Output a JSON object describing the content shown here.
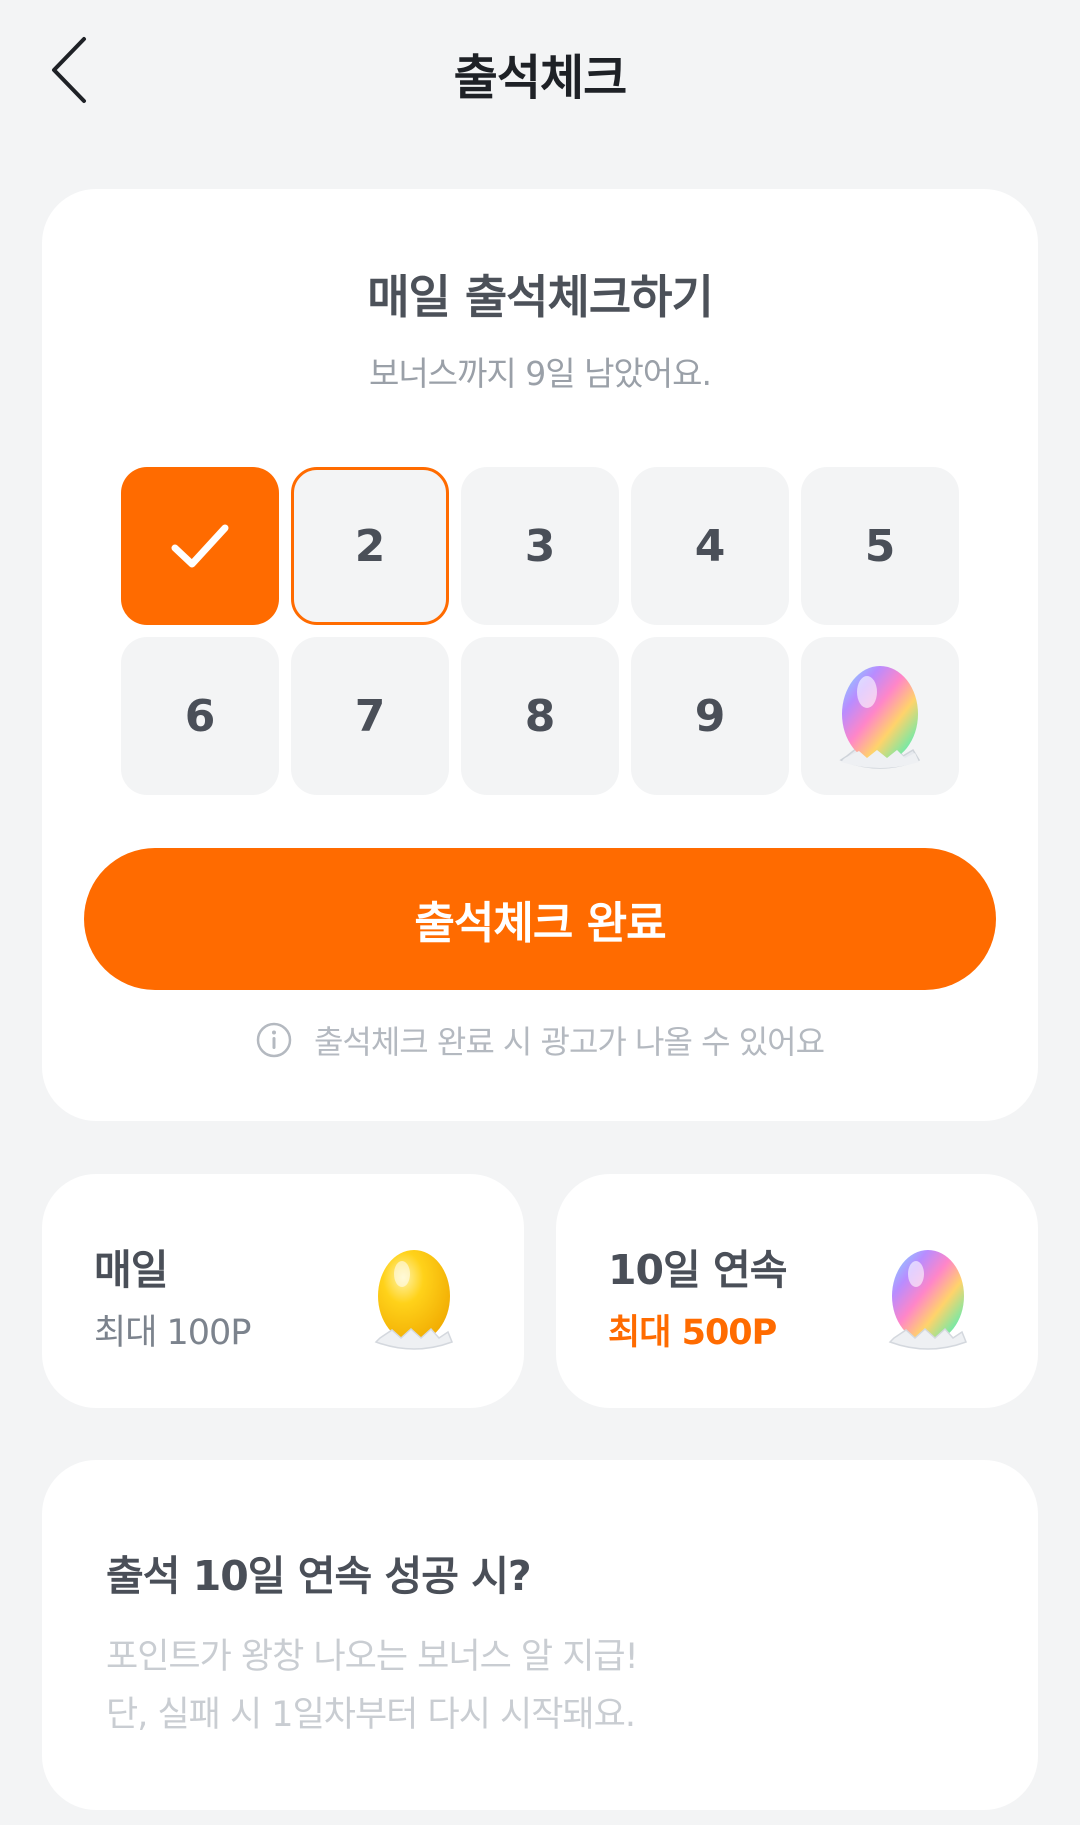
{
  "header": {
    "title": "출석체크",
    "back_icon": "chevron-left-icon"
  },
  "attendance": {
    "title": "매일 출석체크하기",
    "subtitle": "보너스까지 9일 남았어요.",
    "days": [
      {
        "label": "",
        "state": "done",
        "icon": "check-icon"
      },
      {
        "label": "2",
        "state": "today"
      },
      {
        "label": "3",
        "state": "upcoming"
      },
      {
        "label": "4",
        "state": "upcoming"
      },
      {
        "label": "5",
        "state": "upcoming"
      },
      {
        "label": "6",
        "state": "upcoming"
      },
      {
        "label": "7",
        "state": "upcoming"
      },
      {
        "label": "8",
        "state": "upcoming"
      },
      {
        "label": "9",
        "state": "upcoming"
      },
      {
        "label": "",
        "state": "bonus",
        "icon": "rainbow-egg-icon"
      }
    ],
    "cta_label": "출석체크 완료",
    "notice": "출석체크 완료 시 광고가 나올 수 있어요",
    "notice_icon": "info-icon"
  },
  "rewards": {
    "daily": {
      "title": "매일",
      "amount": "최대 100P",
      "icon": "gold-egg-icon"
    },
    "streak": {
      "title": "10일 연속",
      "amount": "최대 500P",
      "icon": "rainbow-egg-icon"
    }
  },
  "bonus": {
    "title": "출석 10일 연속 성공 시?",
    "line1": "포인트가 왕창 나오는 보너스 알 지급!",
    "line2": "단, 실패 시 1일차부터 다시 시작돼요."
  },
  "colors": {
    "accent": "#ff6b00",
    "background": "#f3f4f5",
    "card": "#ffffff",
    "tile": "#f3f4f5"
  }
}
